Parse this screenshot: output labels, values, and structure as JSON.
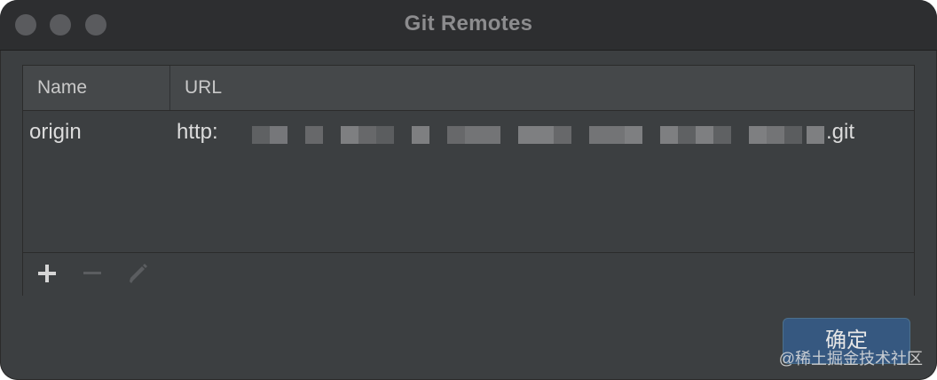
{
  "window": {
    "title": "Git Remotes"
  },
  "table": {
    "columns": [
      "Name",
      "URL"
    ],
    "rows": [
      {
        "name": "origin",
        "url_prefix": "http:",
        "url_suffix": ".git"
      }
    ]
  },
  "toolbar": {
    "add_icon": "plus-icon",
    "remove_icon": "minus-icon",
    "edit_icon": "pencil-icon"
  },
  "buttons": {
    "confirm_label": "确定"
  },
  "watermark": "@稀土掘金技术社区",
  "colors": {
    "window_bg": "#3c3f41",
    "titlebar_bg": "#2d2e30",
    "header_bg": "#45484a",
    "confirm_bg": "#365880",
    "text": "#dcdcdc"
  }
}
